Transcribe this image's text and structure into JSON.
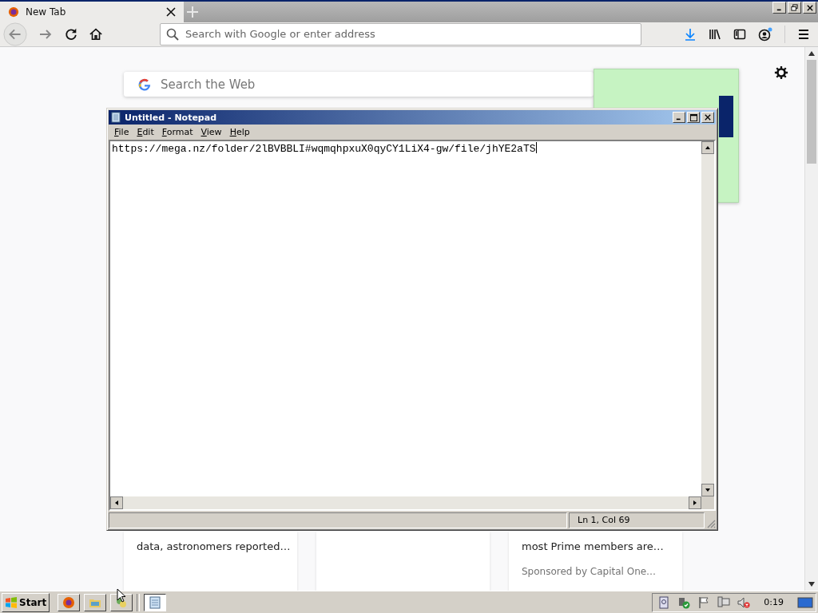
{
  "browser": {
    "tab": {
      "title": "New Tab",
      "selected": true
    },
    "address_bar": {
      "placeholder": "Search with Google or enter address"
    },
    "search": {
      "placeholder": "Search the Web"
    },
    "stories": [
      {
        "kind": "story",
        "snippet": "data, astronomers reported…"
      },
      {
        "kind": "story"
      },
      {
        "kind": "sponsored",
        "snippet": "most Prime members are…",
        "sponsor": "Sponsored by Capital One…"
      }
    ]
  },
  "notepad": {
    "title": "Untitled - Notepad",
    "menu": [
      "File",
      "Edit",
      "Format",
      "View",
      "Help"
    ],
    "text": "https://mega.nz/folder/2lBVBBLI#wqmqhpxuX0qyCY1LiX4-gw/file/jhYE2aTS",
    "status": "Ln 1, Col 69"
  },
  "taskbar": {
    "start": "Start",
    "clock": "0:19",
    "buttons": [
      {
        "kind": "firefox",
        "selected": false
      },
      {
        "kind": "explorer",
        "selected": false
      },
      {
        "kind": "network",
        "selected": false
      },
      {
        "kind": "notepad",
        "selected": true
      }
    ]
  }
}
